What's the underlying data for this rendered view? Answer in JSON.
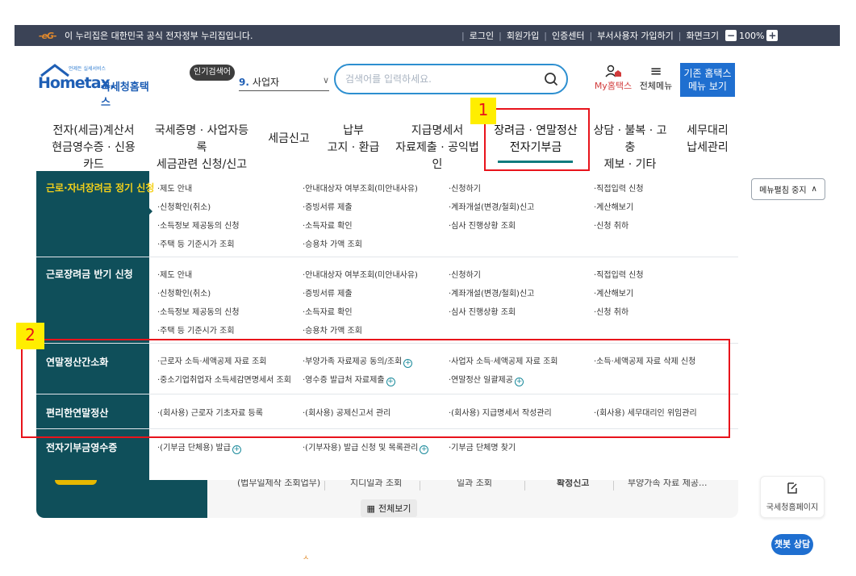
{
  "gov_banner": {
    "logo": "-eG-",
    "text": "이 누리집은 대한민국 공식 전자정부 누리집입니다.",
    "links": [
      "로그인",
      "회원가입",
      "인증센터",
      "부서사용자 가입하기",
      "화면크기"
    ],
    "zoom_minus": "−",
    "zoom_value": "100%",
    "zoom_plus": "+"
  },
  "header": {
    "logo_small": "언제든 실세서비스",
    "logo_main": "Hometax.",
    "logo_kr": "국세청홈택스",
    "popular_tag": "인기검색어",
    "popular_num": "9.",
    "popular_text": "사업자",
    "search_placeholder": "검색어를 입력하세요.",
    "my_hometax": "My홈택스",
    "all_menu": "전체메뉴",
    "old_menu_line1": "기존 홈택스",
    "old_menu_line2": "메뉴 보기"
  },
  "main_nav": [
    {
      "line1": "전자(세금)계산서",
      "line2": "현금영수증 · 신용카드"
    },
    {
      "line1": "국세증명 · 사업자등록",
      "line2": "세금관련 신청/신고"
    },
    {
      "line1": "세금신고",
      "line2": ""
    },
    {
      "line1": "납부",
      "line2": "고지 · 환급"
    },
    {
      "line1": "지급명세서",
      "line2": "자료제출 · 공익법인"
    },
    {
      "line1": "장려금 · 연말정산",
      "line2": "전자기부금"
    },
    {
      "line1": "상담 · 불복 · 고충",
      "line2": "제보 · 기타"
    },
    {
      "line1": "세무대리",
      "line2": "납세관리"
    }
  ],
  "callouts": {
    "first": "1",
    "second": "2"
  },
  "mega_menu": [
    {
      "title": "근로·자녀장려금 정기 신청",
      "links": [
        "·제도 안내",
        "·안내대상자 여부조회(미안내사유)",
        "·신청하기",
        "·직접입력 신청",
        "·신청확인(취소)",
        "·증빙서류 제출",
        "·계좌개설(변경/철회)신고",
        "·계산해보기",
        "·소득정보 제공동의 신청",
        "·소득자료 확인",
        "·심사 진행상황 조회",
        "·신청 취하",
        "·주택 등 기준시가 조회",
        "·승용차 가액 조회"
      ]
    },
    {
      "title": "근로장려금 반기 신청",
      "links": [
        "·제도 안내",
        "·안내대상자 여부조회(미안내사유)",
        "·신청하기",
        "·직접입력 신청",
        "·신청확인(취소)",
        "·증빙서류 제출",
        "·계좌개설(변경/철회)신고",
        "·계산해보기",
        "·소득정보 제공동의 신청",
        "·소득자료 확인",
        "·심사 진행상황 조회",
        "·신청 취하",
        "·주택 등 기준시가 조회",
        "·승용차 가액 조회"
      ]
    },
    {
      "title": "연말정산간소화",
      "links": [
        "·근로자 소득·세액공제 자료 조회",
        "·부양가족 자료제공 동의/조회",
        "·사업자 소득·세액공제 자료 조회",
        "·소득·세액공제 자료 삭제 신청",
        "·중소기업취업자 소득세감면명세서 조회",
        "·영수증 발급처 자료제출",
        "·연말정산 일괄제공"
      ]
    },
    {
      "title": "편리한연말정산",
      "links": [
        "·(회사용) 근로자 기초자료 등록",
        "·(회사용) 공제신고서 관리",
        "·(회사용) 지급명세서 작성관리",
        "·(회사용) 세무대리인 위임관리"
      ]
    },
    {
      "title": "전자기부금영수증",
      "links": [
        "·(기부금 단체용) 발급",
        "·(기부자용) 발급 신청 및 목록관리",
        "·기부금 단체명 찾기"
      ]
    }
  ],
  "menu_toggle": "메뉴펼침 중지",
  "under": {
    "cells": [
      "(법무일제작 조회업무)",
      "지디일과 조회",
      "일과 조회",
      "확정신고",
      "부양가족 자료 제공..."
    ],
    "view_all": "전체보기"
  },
  "hometax_page": "국세청홈페이지",
  "chatbot": "챗봇 상담",
  "small_mark": "ㅅ"
}
